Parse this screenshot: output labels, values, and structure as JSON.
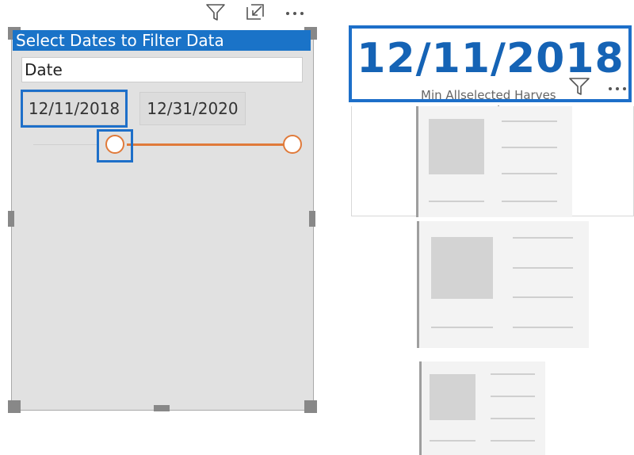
{
  "slicer": {
    "title": "Select Dates to Filter Data",
    "field": "Date",
    "start_date": "12/11/2018",
    "end_date": "12/31/2020",
    "header_icons": [
      "filter-icon",
      "focus-mode-icon",
      "more-options-icon"
    ]
  },
  "card": {
    "value": "12/11/2018",
    "label": "Min Allselected Harves",
    "header_icons": [
      "filter-icon",
      "more-options-icon"
    ]
  },
  "colors": {
    "accent_blue": "#1d6fc9",
    "title_bar": "#1a73c8",
    "slider_orange": "#e07a3a",
    "card_value": "#1563b5"
  }
}
